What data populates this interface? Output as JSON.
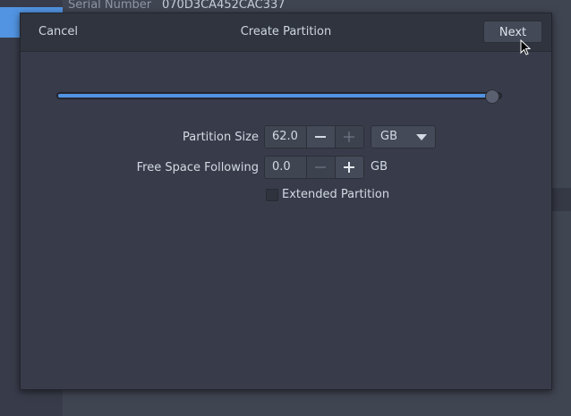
{
  "background": {
    "row1_label": "Serial Number",
    "row1_value": "070D3CA452CAC337"
  },
  "dialog": {
    "title": "Create Partition",
    "cancel_label": "Cancel",
    "next_label": "Next"
  },
  "slider": {
    "fraction": 0.99
  },
  "partition_size": {
    "label": "Partition Size",
    "value": "62.0",
    "unit": "GB"
  },
  "free_space": {
    "label": "Free Space Following",
    "value": "0.0",
    "unit": "GB"
  },
  "extended": {
    "label": "Extended Partition",
    "checked": false
  },
  "colors": {
    "accent": "#5294e2",
    "dialog_bg": "#383c4a",
    "headerbar_bg": "#2f343f"
  },
  "icons": {
    "minus": "minus-icon",
    "plus": "plus-icon",
    "dropdown": "chevron-down-icon",
    "cursor": "mouse-pointer-icon"
  }
}
